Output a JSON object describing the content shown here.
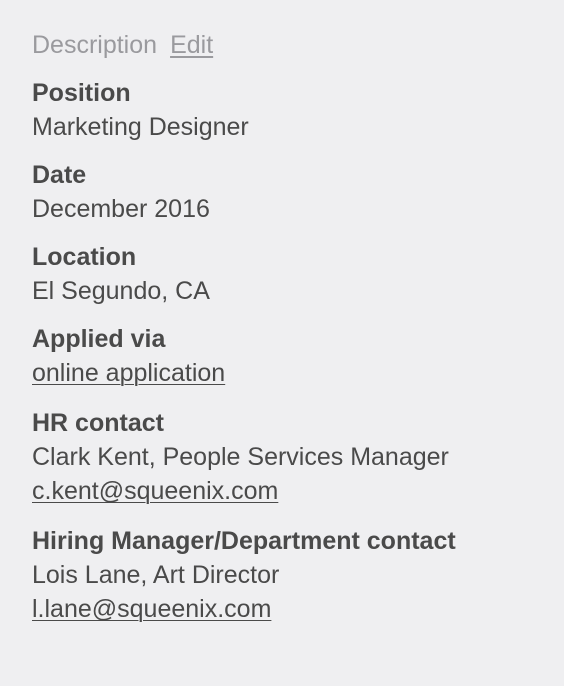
{
  "header": {
    "title": "Description",
    "edit_label": "Edit"
  },
  "fields": {
    "position": {
      "label": "Position",
      "value": "Marketing Designer"
    },
    "date": {
      "label": "Date",
      "value": "December 2016"
    },
    "location": {
      "label": "Location",
      "value": "El Segundo, CA"
    },
    "applied_via": {
      "label": "Applied via",
      "link": "online application"
    },
    "hr_contact": {
      "label": "HR contact",
      "name": "Clark Kent, People Services Manager",
      "email": "c.kent@squeenix.com"
    },
    "hiring_contact": {
      "label": "Hiring Manager/Department contact",
      "name": "Lois Lane, Art Director",
      "email": "l.lane@squeenix.com"
    }
  }
}
